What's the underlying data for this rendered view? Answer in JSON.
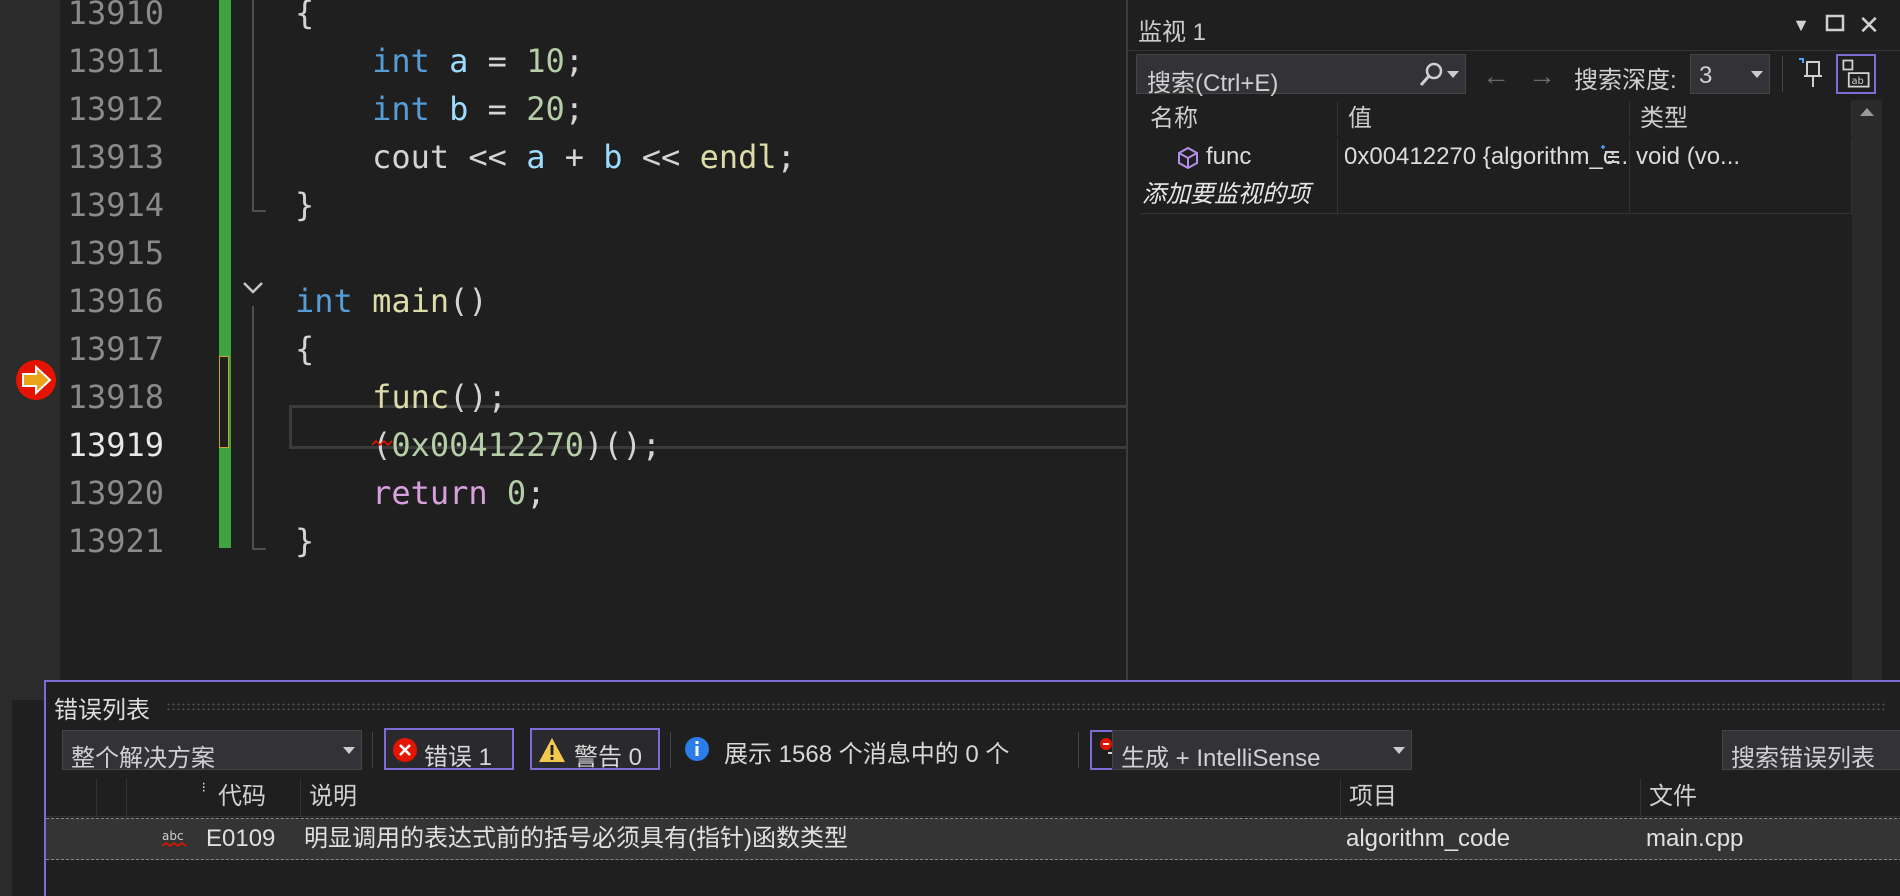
{
  "editor": {
    "lines": [
      {
        "no": "13910",
        "tokens": [
          {
            "t": "{",
            "c": "co"
          }
        ]
      },
      {
        "no": "13911",
        "tokens": [
          {
            "t": "    ",
            "c": "co"
          },
          {
            "t": "int",
            "c": "ck"
          },
          {
            "t": " ",
            "c": "co"
          },
          {
            "t": "a",
            "c": "cv"
          },
          {
            "t": " = ",
            "c": "co"
          },
          {
            "t": "10",
            "c": "cn"
          },
          {
            "t": ";",
            "c": "co"
          }
        ]
      },
      {
        "no": "13912",
        "tokens": [
          {
            "t": "    ",
            "c": "co"
          },
          {
            "t": "int",
            "c": "ck"
          },
          {
            "t": " ",
            "c": "co"
          },
          {
            "t": "b",
            "c": "cv"
          },
          {
            "t": " = ",
            "c": "co"
          },
          {
            "t": "20",
            "c": "cn"
          },
          {
            "t": ";",
            "c": "co"
          }
        ]
      },
      {
        "no": "13913",
        "tokens": [
          {
            "t": "    cout << ",
            "c": "co"
          },
          {
            "t": "a",
            "c": "cv"
          },
          {
            "t": " + ",
            "c": "co"
          },
          {
            "t": "b",
            "c": "cv"
          },
          {
            "t": " << ",
            "c": "co"
          },
          {
            "t": "endl",
            "c": "cf"
          },
          {
            "t": ";",
            "c": "co"
          }
        ]
      },
      {
        "no": "13914",
        "tokens": [
          {
            "t": "}",
            "c": "co"
          }
        ]
      },
      {
        "no": "13915",
        "tokens": []
      },
      {
        "no": "13916",
        "tokens": [
          {
            "t": "int",
            "c": "ck"
          },
          {
            "t": " ",
            "c": "co"
          },
          {
            "t": "main",
            "c": "cf"
          },
          {
            "t": "()",
            "c": "co"
          }
        ]
      },
      {
        "no": "13917",
        "tokens": [
          {
            "t": "{",
            "c": "co"
          }
        ]
      },
      {
        "no": "13918",
        "tokens": [
          {
            "t": "    ",
            "c": "co"
          },
          {
            "t": "func",
            "c": "cf"
          },
          {
            "t": "();",
            "c": "co"
          }
        ]
      },
      {
        "no": "13919",
        "tokens": [
          {
            "t": "    (",
            "c": "co"
          },
          {
            "t": "0x00412270",
            "c": "cn"
          },
          {
            "t": ")();",
            "c": "co"
          }
        ],
        "current": true
      },
      {
        "no": "13920",
        "tokens": [
          {
            "t": "    ",
            "c": "co"
          },
          {
            "t": "return",
            "c": "cp"
          },
          {
            "t": " ",
            "c": "co"
          },
          {
            "t": "0",
            "c": "cn"
          },
          {
            "t": ";",
            "c": "co"
          }
        ]
      },
      {
        "no": "13921",
        "tokens": [
          {
            "t": "}",
            "c": "co"
          }
        ]
      }
    ]
  },
  "watch": {
    "title": "监视 1",
    "search_placeholder": "搜索(Ctrl+E)",
    "depth_label": "搜索深度:",
    "depth_value": "3",
    "columns": {
      "name": "名称",
      "value": "值",
      "type": "类型"
    },
    "rows": [
      {
        "name": "func",
        "value": "0x00412270 {algorithm_c...",
        "type": "void (vo..."
      }
    ],
    "add_item": "添加要监视的项"
  },
  "errors": {
    "title": "错误列表",
    "scope": "整个解决方案",
    "errors_btn": "错误 1",
    "warnings_btn": "警告 0",
    "messages": "展示 1568 个消息中的 0 个",
    "build": "生成 + IntelliSense",
    "search_placeholder": "搜索错误列表",
    "columns": {
      "code": "代码",
      "description": "说明",
      "project": "项目",
      "file": "文件"
    },
    "rows": [
      {
        "code": "E0109",
        "description": "明显调用的表达式前的括号必须具有(指针)函数类型",
        "project": "algorithm_code",
        "file": "main.cpp"
      }
    ]
  },
  "colors": {
    "accent": "#7e6bd8",
    "change_bar": "#3fa33f",
    "error": "#e51400",
    "execution_arrow": "#e8a317"
  },
  "icons": [
    "execution-arrow-icon",
    "chevron-down-icon",
    "search-icon",
    "back-arrow-icon",
    "forward-arrow-icon",
    "pin-icon",
    "hex-display-icon",
    "variable-cube-icon",
    "visualizer-icon",
    "error-icon",
    "warning-icon",
    "info-icon",
    "filter-icon",
    "spellcheck-icon"
  ]
}
